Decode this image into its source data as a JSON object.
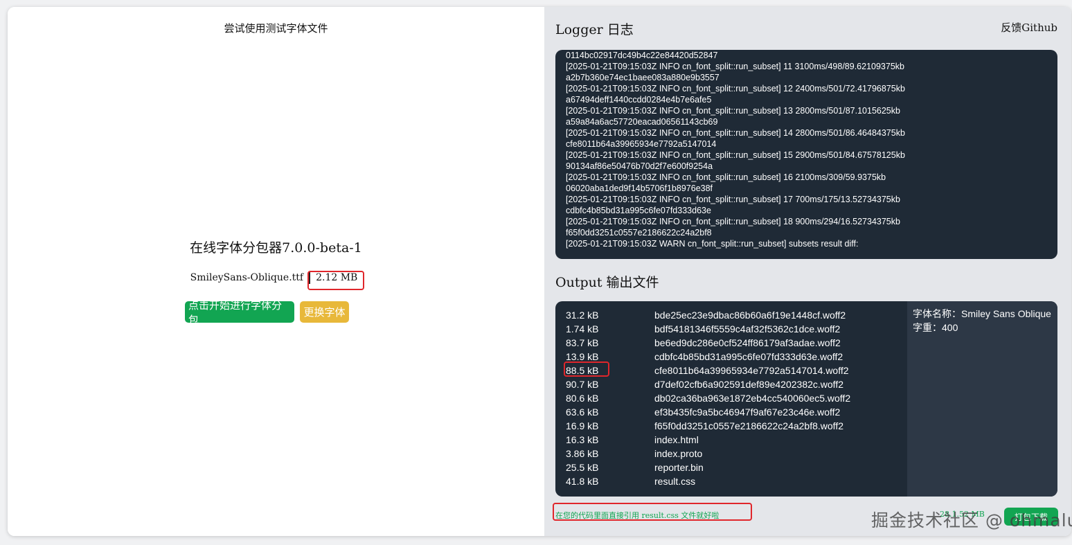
{
  "left": {
    "test_link": "尝试使用测试字体文件",
    "title": "在线字体分包器7.0.0-beta-1",
    "file_name": "SmileySans-Oblique.ttf",
    "file_size": "2.12 MB",
    "start_button": "点击开始进行字体分包",
    "change_button": "更换字体"
  },
  "right": {
    "logger_title": "Logger  日志",
    "github_link": "反馈Github",
    "log_lines": [
      "0114bc02917dc49b4c22e84420d52847",
      "[2025-01-21T09:15:03Z INFO cn_font_split::run_subset] 11 3100ms/498/89.62109375kb",
      "a2b7b360e74ec1baee083a880e9b3557",
      "[2025-01-21T09:15:03Z INFO cn_font_split::run_subset] 12 2400ms/501/72.41796875kb",
      "a67494deff1440ccdd0284e4b7e6afe5",
      "[2025-01-21T09:15:03Z INFO cn_font_split::run_subset] 13 2800ms/501/87.1015625kb",
      "a59a84a6ac57720eacad06561143cb69",
      "[2025-01-21T09:15:03Z INFO cn_font_split::run_subset] 14 2800ms/501/86.46484375kb",
      "cfe8011b64a39965934e7792a5147014",
      "[2025-01-21T09:15:03Z INFO cn_font_split::run_subset] 15 2900ms/501/84.67578125kb",
      "90134af86e50476b70d2f7e600f9254a",
      "[2025-01-21T09:15:03Z INFO cn_font_split::run_subset] 16 2100ms/309/59.9375kb",
      "06020aba1ded9f14b5706f1b8976e38f",
      "[2025-01-21T09:15:03Z INFO cn_font_split::run_subset] 17 700ms/175/13.52734375kb",
      "cdbfc4b85bd31a995c6fe07fd333d63e",
      "[2025-01-21T09:15:03Z INFO cn_font_split::run_subset] 18 900ms/294/16.52734375kb",
      "f65f0dd3251c0557e2186622c24a2bf8",
      "[2025-01-21T09:15:03Z WARN cn_font_split::run_subset] subsets result diff:"
    ],
    "output_title": "Output  输出文件",
    "output_files": [
      {
        "size": "31.2 kB",
        "name": "bde25ec23e9dbac86b60a6f19e1448cf.woff2"
      },
      {
        "size": "1.74 kB",
        "name": "bdf54181346f5559c4af32f5362c1dce.woff2"
      },
      {
        "size": "83.7 kB",
        "name": "be6ed9dc286e0cf524ff86179af3adae.woff2"
      },
      {
        "size": "13.9 kB",
        "name": "cdbfc4b85bd31a995c6fe07fd333d63e.woff2"
      },
      {
        "size": "88.5 kB",
        "name": "cfe8011b64a39965934e7792a5147014.woff2"
      },
      {
        "size": "90.7 kB",
        "name": "d7def02cfb6a902591def89e4202382c.woff2"
      },
      {
        "size": "80.6 kB",
        "name": "db02ca36ba963e1872eb4cc540060ec5.woff2"
      },
      {
        "size": "63.6 kB",
        "name": "ef3b435fc9a5bc46947f9af67e23c46e.woff2"
      },
      {
        "size": "16.9 kB",
        "name": "f65f0dd3251c0557e2186622c24a2bf8.woff2"
      },
      {
        "size": "16.3 kB",
        "name": "index.html"
      },
      {
        "size": "3.86 kB",
        "name": "index.proto"
      },
      {
        "size": "25.5 kB",
        "name": "reporter.bin"
      },
      {
        "size": "41.8 kB",
        "name": "result.css"
      }
    ],
    "font_name_label": "字体名称：Smiley Sans Oblique",
    "font_weight_label": "字重：400",
    "hint": "在您的代码里面直接引用 result.css 文件就好啦",
    "total_size": "28.1.52 MB",
    "download_button": "打包下载"
  },
  "watermark": "掘金技术社区 @ ohmalu",
  "colors": {
    "accent_green": "#12a552",
    "accent_yellow": "#e8b83a",
    "dark_panel": "#1f2a36",
    "highlight_red": "#e0262b"
  }
}
